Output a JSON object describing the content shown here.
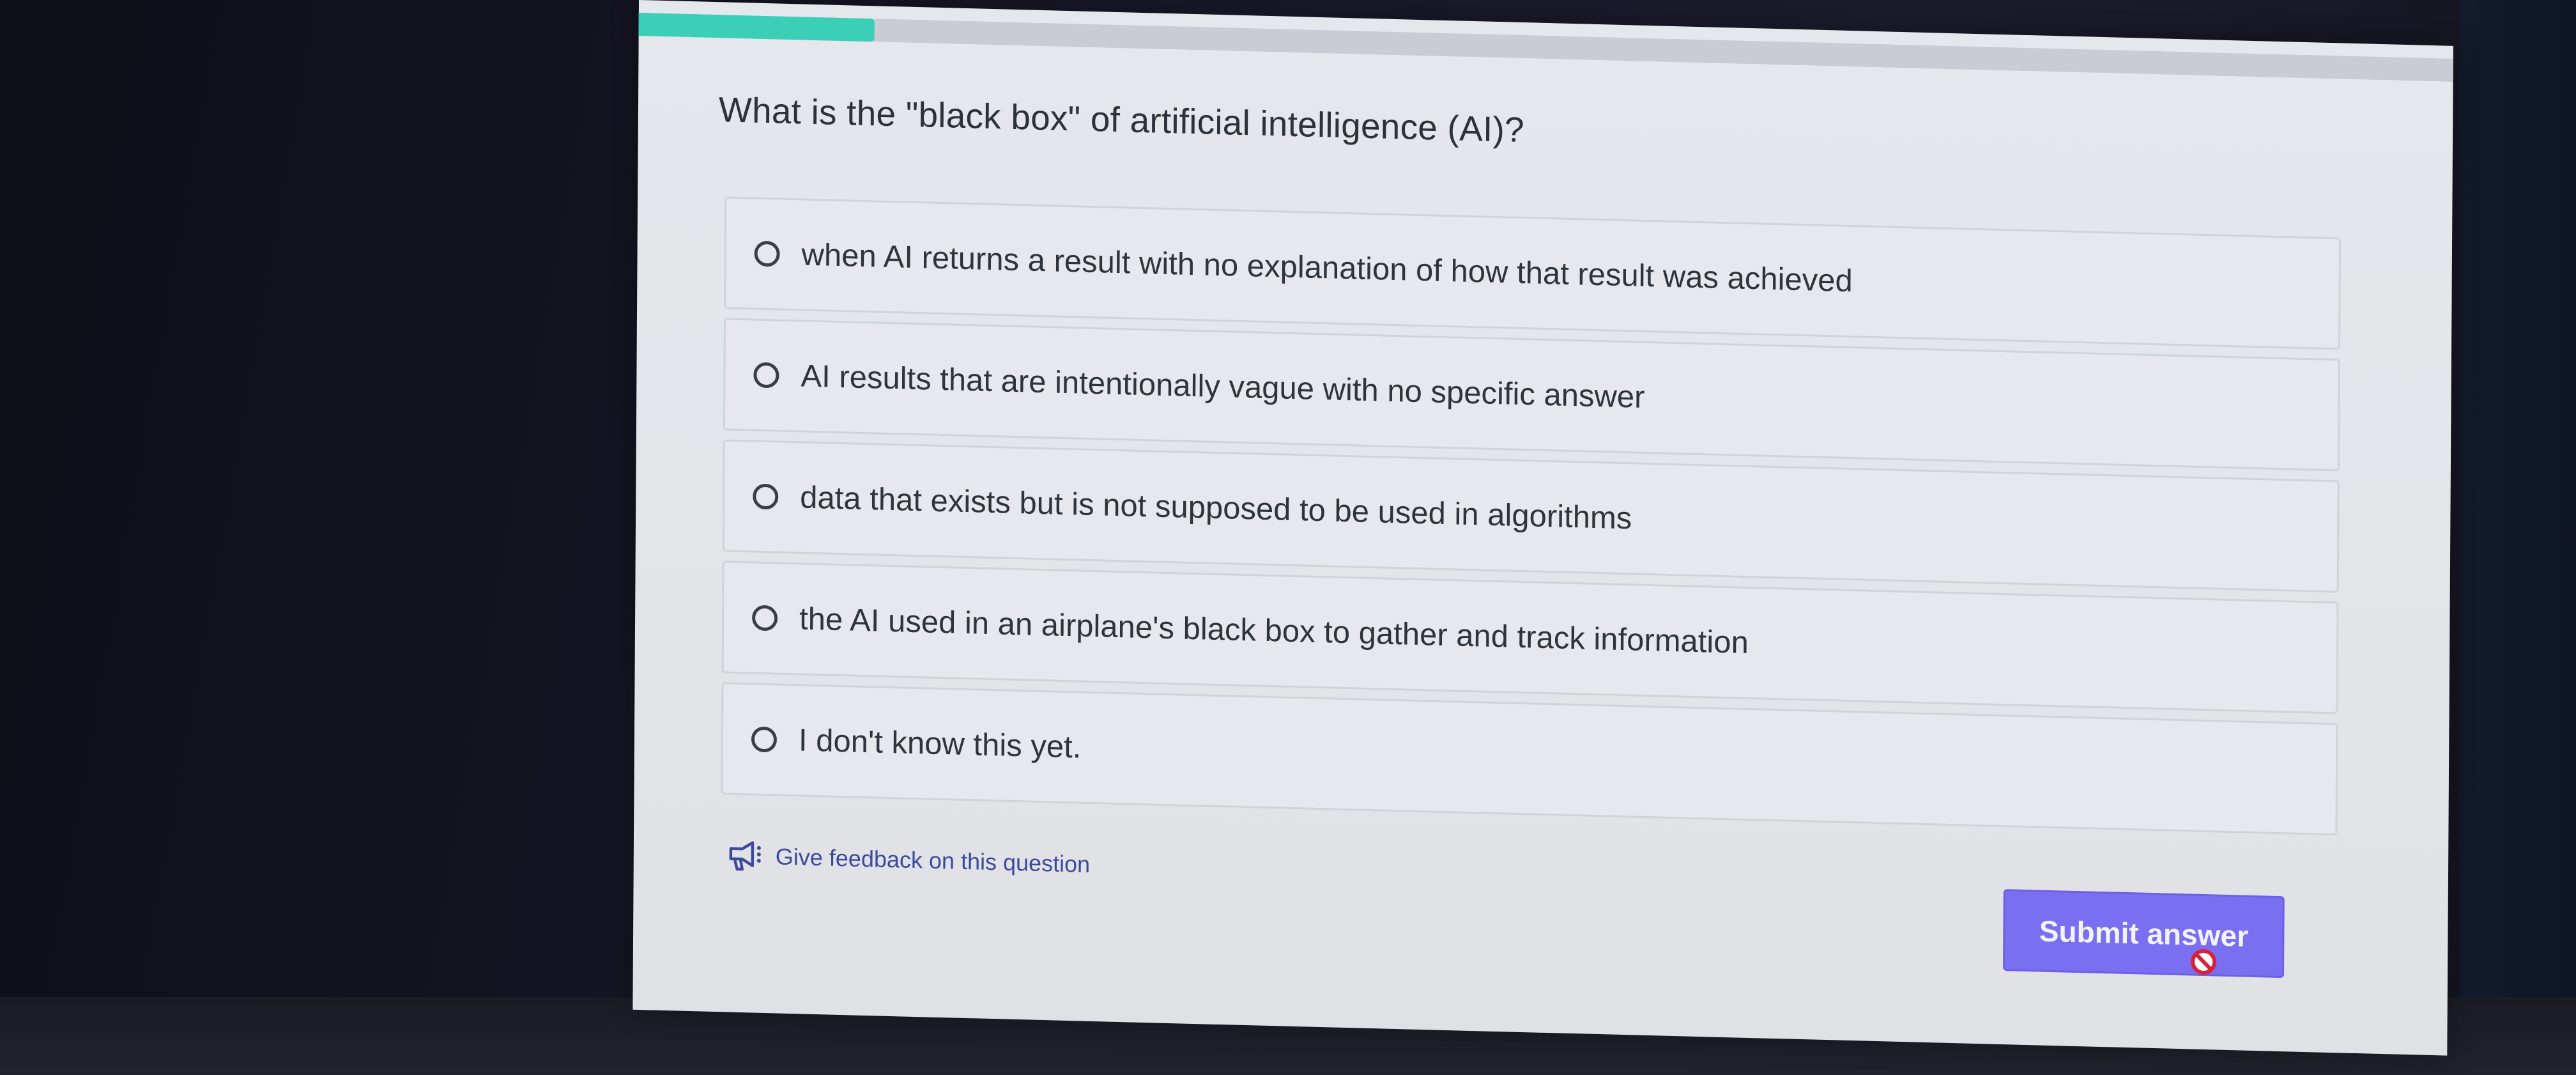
{
  "quiz": {
    "progress_fraction": 0.13,
    "question": "What is the \"black box\" of artificial intelligence (AI)?",
    "options": [
      {
        "label": "when AI returns a result with no explanation of how that result was achieved"
      },
      {
        "label": "AI results that are intentionally vague with no specific answer"
      },
      {
        "label": "data that exists but is not supposed to be used in algorithms"
      },
      {
        "label": "the AI used in an airplane's black box to gather and track information"
      },
      {
        "label": "I don't know this yet."
      }
    ],
    "feedback_label": "Give feedback on this question",
    "submit_label": "Submit answer"
  },
  "colors": {
    "progress": "#3ccfb8",
    "submit": "#7a6ff0",
    "feedback_link": "#3c4a9e",
    "disabled_cursor": "#d8213a"
  },
  "icons": {
    "feedback": "megaphone-icon",
    "cursor": "no-entry-icon"
  }
}
